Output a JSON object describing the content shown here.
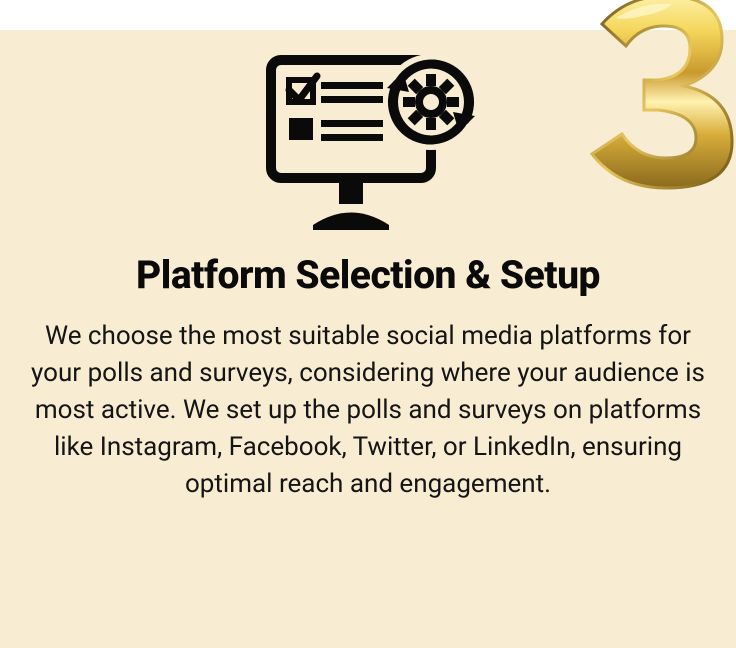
{
  "card": {
    "icon_name": "monitor-checklist-gear-icon",
    "title": "Platform Selection & Setup",
    "body": "We choose the most suitable social media platforms for your polls and surveys, considering where your audience is most active. We set up the polls and surveys on platforms like Instagram, Facebook, Twitter, or LinkedIn, ensuring optimal reach and engagement.",
    "step_number": "3"
  },
  "colors": {
    "card_bg": "#f8ecd2",
    "text": "#0a0a0a",
    "gold_light": "#f7e27a",
    "gold_mid": "#d4a730",
    "gold_dark": "#8a6a1c"
  }
}
